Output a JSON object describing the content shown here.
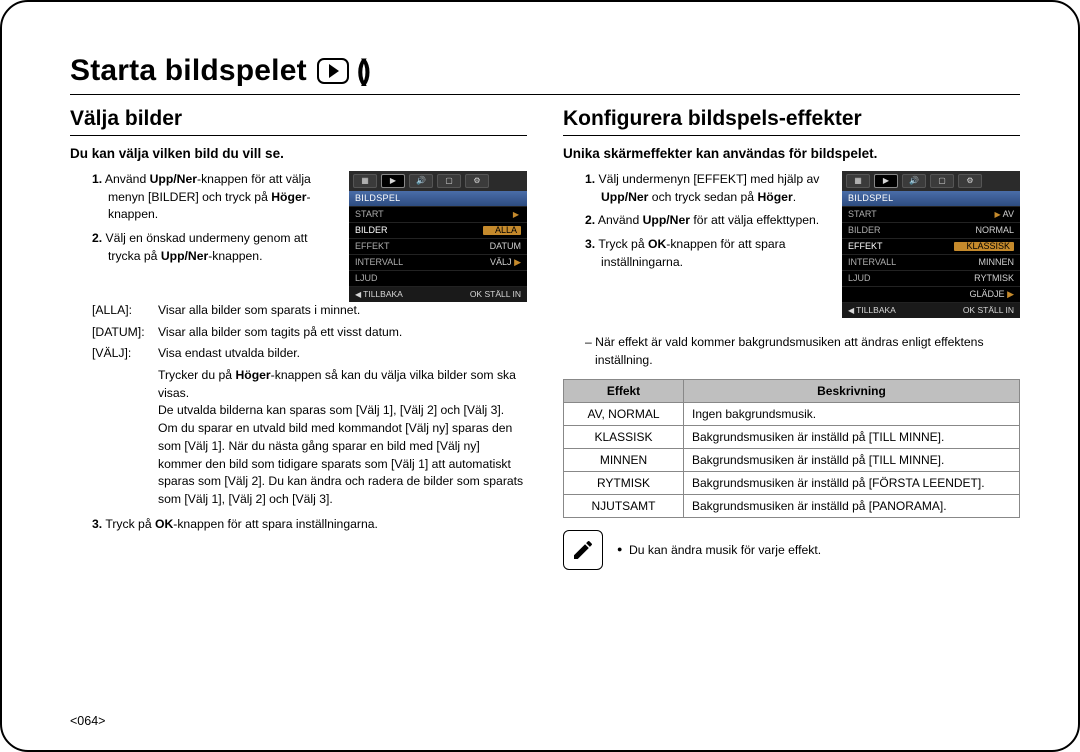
{
  "page_title": "Starta bildspelet",
  "page_number": "<064>",
  "left": {
    "section_title": "Välja bilder",
    "sub_heading": "Du kan välja vilken bild du vill se.",
    "steps": {
      "s1": "Använd Upp/Ner-knappen för att välja menyn [BILDER] och tryck på Höger-knappen.",
      "s2": "Välj en önskad undermeny genom att trycka på Upp/Ner-knappen."
    },
    "defs": {
      "alla_k": "[ALLA]:",
      "alla_v": "Visar alla bilder som sparats i minnet.",
      "datum_k": "[DATUM]:",
      "datum_v": "Visar alla bilder som tagits på ett visst datum.",
      "valj_k": "[VÄLJ]:",
      "valj_v": "Visa endast utvalda bilder."
    },
    "extra1": "Trycker du på Höger-knappen så kan du välja vilka bilder som ska visas.",
    "extra2": "De utvalda bilderna kan sparas som [Välj 1], [Välj 2] och [Välj 3]. Om du sparar en utvald bild med kommandot [Välj ny] sparas den som [Välj 1]. När du nästa gång sparar en bild med [Välj ny] kommer den bild som tidigare sparats som [Välj 1] att automatiskt sparas som [Välj 2]. Du kan ändra och radera de bilder som sparats som [Välj 1], [Välj 2] och [Välj 3].",
    "s3": "Tryck på OK-knappen för att spara inställningarna.",
    "cam": {
      "hdr": "BILDSPEL",
      "start_k": "START",
      "start_v": "",
      "bilder_k": "BILDER",
      "bilder_v": "ALLA",
      "effekt_k": "EFFEKT",
      "effekt_v": "DATUM",
      "intervall_k": "INTERVALL",
      "intervall_v": "VÄLJ",
      "ljud_k": "LJUD",
      "foot_l": "TILLBAKA",
      "foot_r": "OK STÄLL IN"
    }
  },
  "right": {
    "section_title": "Konfigurera bildspels-effekter",
    "sub_heading": "Unika skärmeffekter kan användas för bildspelet.",
    "steps": {
      "s1": "Välj undermenyn [EFFEKT] med hjälp av Upp/Ner och tryck sedan på Höger.",
      "s2": "Använd Upp/Ner för att välja effekttypen.",
      "s3": "Tryck på OK-knappen för att spara inställningarna."
    },
    "dash_note": "– När effekt är vald kommer bakgrundsmusiken att ändras enligt effektens inställning.",
    "table": {
      "head_effect": "Effekt",
      "head_desc": "Beskrivning",
      "rows": [
        {
          "k": "AV, NORMAL",
          "v": "Ingen bakgrundsmusik."
        },
        {
          "k": "KLASSISK",
          "v": "Bakgrundsmusiken är inställd på [TILL MINNE]."
        },
        {
          "k": "MINNEN",
          "v": "Bakgrundsmusiken är inställd på [TILL MINNE]."
        },
        {
          "k": "RYTMISK",
          "v": "Bakgrundsmusiken är inställd på [FÖRSTA LEENDET]."
        },
        {
          "k": "NJUTSAMT",
          "v": "Bakgrundsmusiken är inställd på [PANORAMA]."
        }
      ]
    },
    "note": "Du kan ändra musik för varje effekt.",
    "cam": {
      "hdr": "BILDSPEL",
      "start_k": "START",
      "start_v": "AV",
      "bilder_k": "BILDER",
      "bilder_v": "NORMAL",
      "effekt_k": "EFFEKT",
      "effekt_v": "KLASSISK",
      "intervall_k": "INTERVALL",
      "intervall_v": "MINNEN",
      "ljud_k": "LJUD",
      "ljud_v": "RYTMISK",
      "extra_v": "GLÄDJE",
      "foot_l": "TILLBAKA",
      "foot_r": "OK STÄLL IN"
    }
  }
}
